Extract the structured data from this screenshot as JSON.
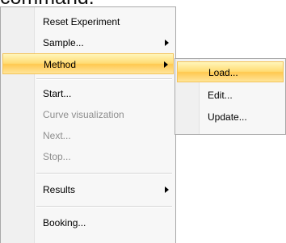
{
  "caption": {
    "partial_text": "command."
  },
  "menu": {
    "items": [
      {
        "label": "Reset Experiment",
        "enabled": true,
        "has_submenu": false
      },
      {
        "label": "Sample...",
        "enabled": true,
        "has_submenu": true,
        "submenu_arrow_icon": "chevron-right-icon"
      },
      {
        "label": "Method",
        "enabled": true,
        "has_submenu": true,
        "highlighted": true,
        "submenu_arrow_icon": "chevron-right-icon"
      },
      {
        "label": "Start...",
        "enabled": true,
        "has_submenu": false
      },
      {
        "label": "Curve visualization",
        "enabled": false,
        "has_submenu": false
      },
      {
        "label": "Next...",
        "enabled": false,
        "has_submenu": false
      },
      {
        "label": "Stop...",
        "enabled": false,
        "has_submenu": false
      },
      {
        "label": "Results",
        "enabled": true,
        "has_submenu": true,
        "submenu_arrow_icon": "chevron-right-icon"
      },
      {
        "label": "Booking...",
        "enabled": true,
        "has_submenu": false
      }
    ]
  },
  "submenu": {
    "parent": "Method",
    "items": [
      {
        "label": "Load...",
        "highlighted": true
      },
      {
        "label": "Edit..."
      },
      {
        "label": "Update..."
      }
    ]
  },
  "colors": {
    "menu_background": "#f7f7f7",
    "menu_border": "#a9a9a9",
    "disabled_text": "#8e8e8e",
    "highlight": "#ffc84f"
  }
}
